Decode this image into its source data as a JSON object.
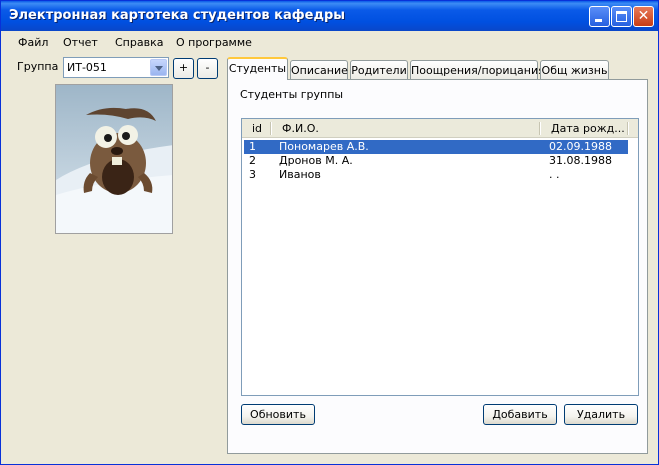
{
  "window": {
    "title": "Электронная картотека студентов кафедры"
  },
  "menu": [
    "Файл",
    "Отчет",
    "Справка",
    "О программе"
  ],
  "group": {
    "label": "Группа",
    "value": "ИТ-051",
    "add_label": "+",
    "remove_label": "-"
  },
  "tabs": [
    "Студенты",
    "Описание",
    "Родители",
    "Поощрения/порицания",
    "Общ жизнь"
  ],
  "active_tab": "Студенты",
  "students_panel": {
    "caption": "Студенты группы",
    "columns": [
      "id",
      "Ф.И.О.",
      "Дата рожд..."
    ],
    "rows": [
      {
        "id": "1",
        "name": "Пономарев А.В.",
        "dob": "02.09.1988",
        "selected": true
      },
      {
        "id": "2",
        "name": "Дронов М. А.",
        "dob": "31.08.1988",
        "selected": false
      },
      {
        "id": "3",
        "name": "Иванов",
        "dob": ". .",
        "selected": false
      }
    ],
    "refresh_label": "Обновить",
    "add_label": "Добавить",
    "delete_label": "Удалить"
  }
}
